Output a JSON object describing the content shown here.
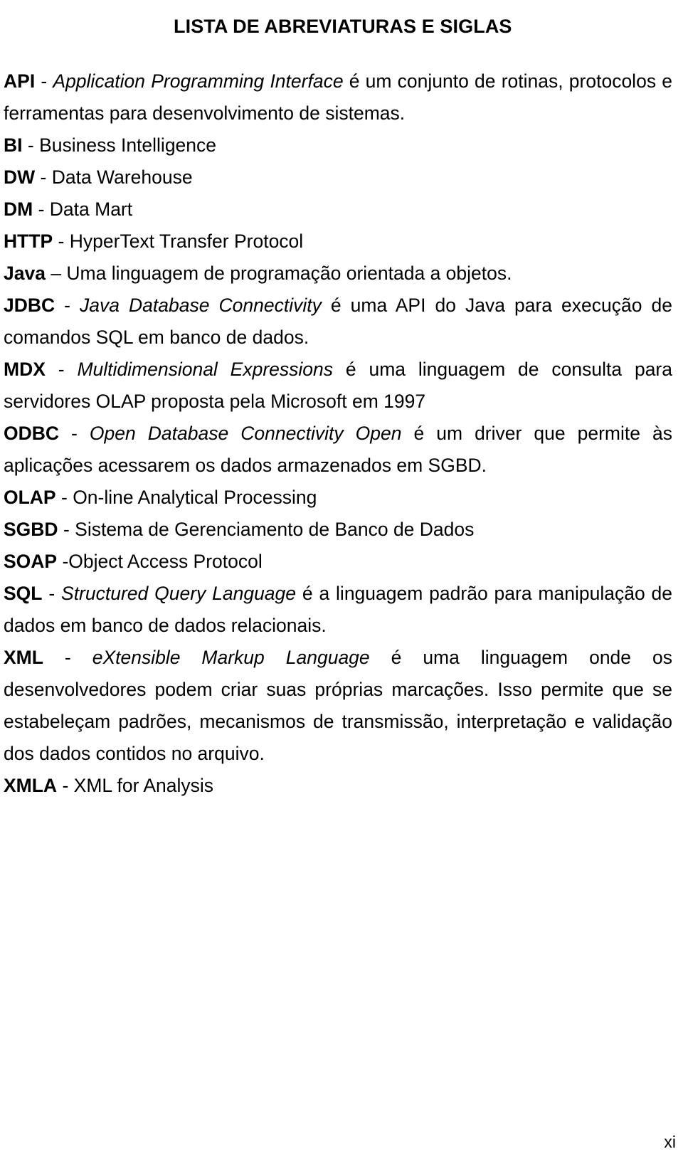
{
  "page": {
    "title": "LISTA DE ABREVIATURAS E SIGLAS",
    "folio": "xi",
    "colors": {
      "background": "#ffffff",
      "text": "#000000"
    }
  },
  "entries": [
    {
      "term": "API",
      "separator": " - ",
      "expansion": "Application Programming Interface",
      "rest": " é um conjunto de rotinas, protocolos e ferramentas para desenvolvimento de sistemas.",
      "multiline": true
    },
    {
      "term": "BI",
      "separator": " - ",
      "expansion": "",
      "rest": "Business Intelligence",
      "multiline": false
    },
    {
      "term": "DW",
      "separator": " - ",
      "expansion": "",
      "rest": "Data Warehouse",
      "multiline": false
    },
    {
      "term": "DM",
      "separator": " - ",
      "expansion": "",
      "rest": "Data Mart",
      "multiline": false
    },
    {
      "term": "HTTP",
      "separator": " - ",
      "expansion": "",
      "rest": "HyperText Transfer Protocol",
      "multiline": false
    },
    {
      "term": "Java",
      "separator": " – ",
      "expansion": "",
      "rest": "Uma linguagem de programação orientada a objetos.",
      "multiline": false
    },
    {
      "term": "JDBC",
      "separator": " - ",
      "expansion": "Java Database Connectivity",
      "rest": " é uma API do Java para execução de comandos SQL em banco de dados.",
      "multiline": true
    },
    {
      "term": "MDX",
      "separator": " - ",
      "expansion": "Multidimensional Expressions",
      "rest": " é uma linguagem de consulta para servidores OLAP proposta pela Microsoft em 1997",
      "multiline": true
    },
    {
      "term": "ODBC",
      "separator": " - ",
      "expansion": "Open Database Connectivity Open",
      "rest": " é um driver que permite às aplicações acessarem os dados armazenados em SGBD.",
      "multiline": true
    },
    {
      "term": "OLAP",
      "separator": " - ",
      "expansion": "",
      "rest": "On-line Analytical Processing",
      "multiline": false
    },
    {
      "term": "SGBD",
      "separator": " - ",
      "expansion": "",
      "rest": "Sistema de Gerenciamento de Banco de Dados",
      "multiline": false
    },
    {
      "term": "SOAP",
      "separator": " -",
      "expansion": "",
      "rest": "Object Access Protocol",
      "multiline": false
    },
    {
      "term": "SQL",
      "separator": " - ",
      "expansion": "Structured Query Language",
      "rest": " é a linguagem padrão para manipulação de dados em banco de dados relacionais.",
      "multiline": true
    },
    {
      "term": "XML",
      "separator": " - ",
      "expansion": "eXtensible Markup Language",
      "rest": " é uma linguagem onde os desenvolvedores podem criar suas próprias marcações. Isso permite que se estabeleçam padrões, mecanismos de transmissão, interpretação e validação dos dados contidos no arquivo.",
      "multiline": true
    },
    {
      "term": "XMLA",
      "separator": " - ",
      "expansion": "",
      "rest": "XML for Analysis",
      "multiline": false
    }
  ]
}
